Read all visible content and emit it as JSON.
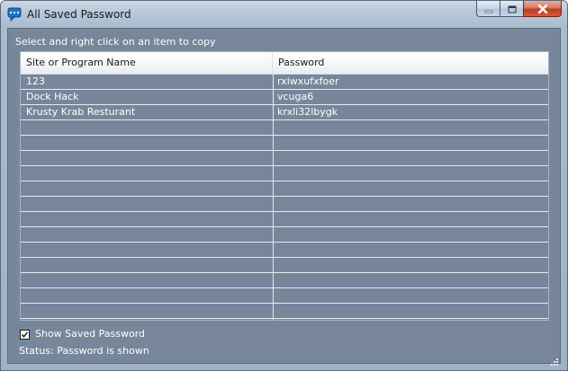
{
  "window": {
    "title": "All Saved Password"
  },
  "instruction": "Select and right click on an item to copy",
  "table": {
    "columns": [
      "Site or Program Name",
      "Password"
    ],
    "rows": [
      {
        "site": "123",
        "password": "rxiwxufxfoer"
      },
      {
        "site": "Dock Hack",
        "password": "vcuga6"
      },
      {
        "site": "Krusty Krab Resturant",
        "password": "krxli32lbygk"
      }
    ]
  },
  "checkbox": {
    "label": "Show Saved Password",
    "checked": true
  },
  "status": "Status: Password is shown",
  "icons": {
    "app": "chat-bubble-icon",
    "minimize": "minimize-icon",
    "maximize": "maximize-icon",
    "close": "close-icon",
    "grip": "resize-grip-icon"
  },
  "colors": {
    "client_bg": "#77869a",
    "close_button": "#c0391f"
  }
}
